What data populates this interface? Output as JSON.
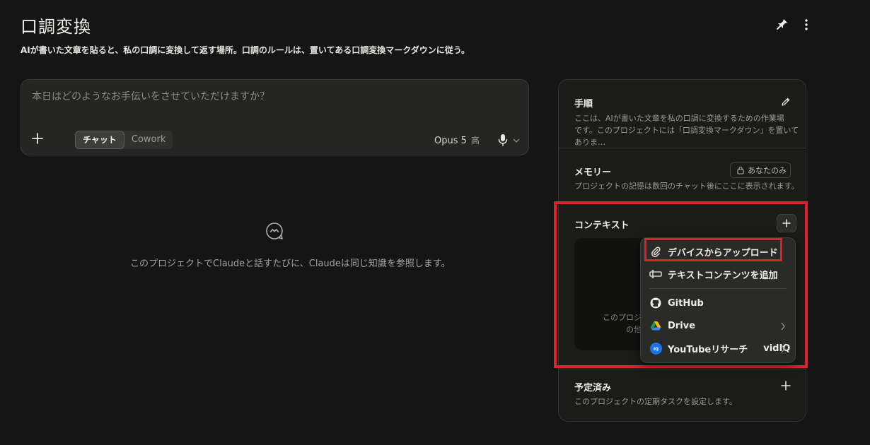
{
  "header": {
    "title": "口調変換",
    "subtitle": "AIが書いた文章を貼ると、私の口調に変換して返す場所。口調のルールは、置いてある口調変換マークダウンに従う。"
  },
  "composer": {
    "placeholder": "本日はどのようなお手伝いをさせていただけますか？",
    "modes": [
      "チャット",
      "Cowork"
    ],
    "active_mode": "チャット",
    "model": "Opus 5",
    "effort": "高"
  },
  "empty_state": {
    "text": "このプロジェクトでClaudeと話すたびに、Claudeは同じ知識を参照します。"
  },
  "sidebar": {
    "instructions": {
      "title": "手順",
      "desc_line1": "ここは、AIが書いた文章を私の口調に変換するための作業場",
      "desc_line2": "です。このプロジェクトには「口調変換マークダウン」を置いてありま…"
    },
    "memory": {
      "title": "メモリー",
      "badge": "あなたのみ",
      "desc": "プロジェクトの記憶は数回のチャット後にここに表示されます。"
    },
    "context": {
      "title": "コンテキスト",
      "drop_text_line1": "このプロジェ",
      "drop_text_line2": "の他"
    },
    "scheduled": {
      "title": "予定済み",
      "desc": "このプロジェクトの定期タスクを設定します。"
    }
  },
  "menu": {
    "upload": "デバイスからアップロード",
    "add_text": "テキストコンテンツを追加",
    "github": "GitHub",
    "drive": "Drive",
    "youtube": "YouTubeリサーチ",
    "vidiq": "vidIQ"
  },
  "colors": {
    "background": "#151515",
    "highlight": "#e0212b",
    "drive_blue": "#4285f4",
    "vidiq_blue": "#1a73e8"
  }
}
